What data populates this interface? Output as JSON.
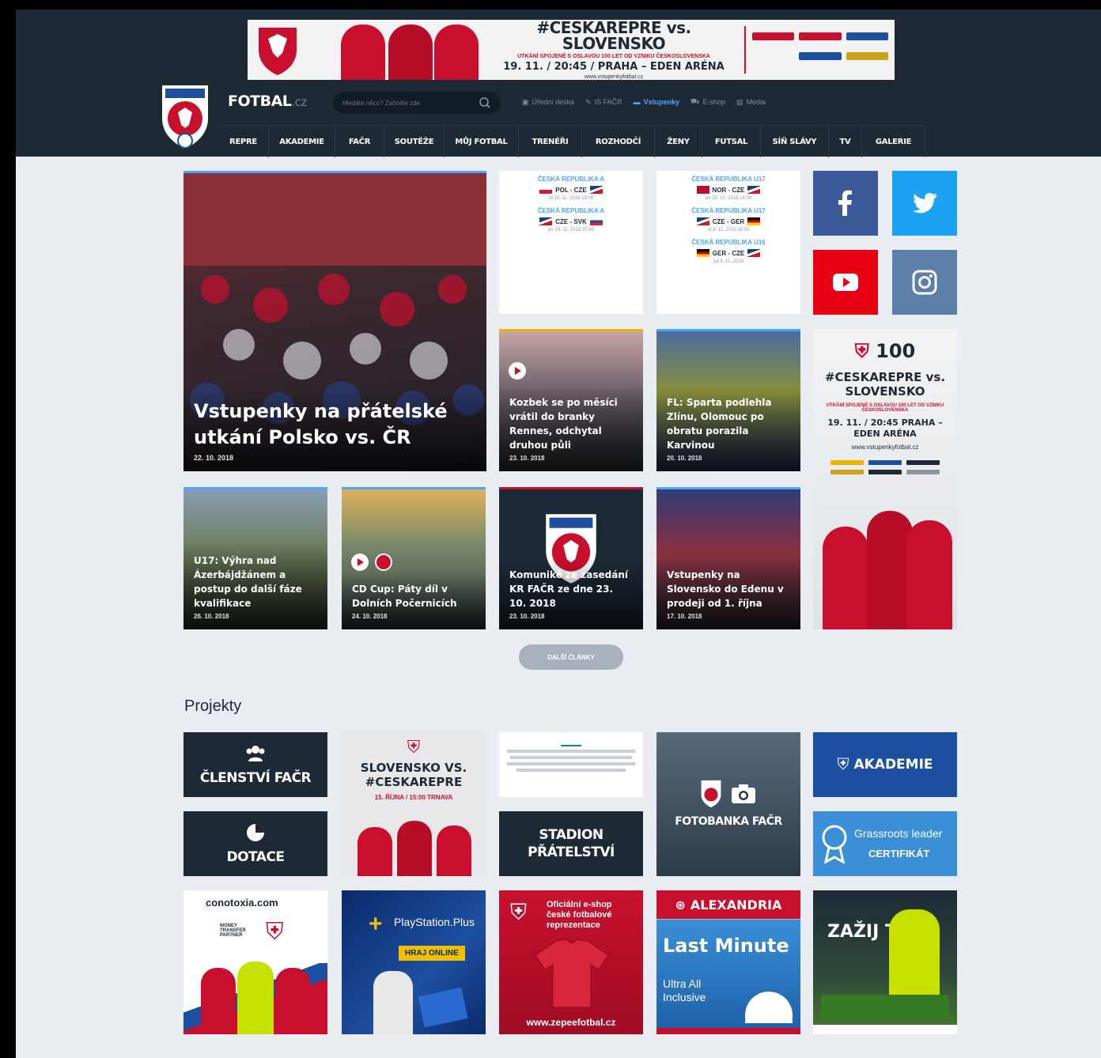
{
  "banner": {
    "headline": "#CESKAREPRE vs. SLOVENSKO",
    "subline": "UTKÁNÍ SPOJENÉ S OSLAVOU 100 LET OD VZNIKU ČESKOSLOVENSKA",
    "date_place": "19. 11. / 20:45 / PRAHA – EDEN ARÉNA",
    "url": "www.vstupenkyfotbal.cz"
  },
  "header": {
    "brand": "FOTBAL",
    "brand_suffix": ".cz",
    "search_placeholder": "Hledáte něco? Začněte zde",
    "links": [
      {
        "label": "Úřední deska",
        "icon": "calendar-icon",
        "glyph": "▣"
      },
      {
        "label": "IS FAČR",
        "icon": "pencil-icon",
        "glyph": "✎"
      },
      {
        "label": "Vstupenky",
        "icon": "ticket-icon",
        "glyph": "▬"
      },
      {
        "label": "E-shop",
        "icon": "cart-icon",
        "glyph": "⛟"
      },
      {
        "label": "Média",
        "icon": "media-icon",
        "glyph": "▤"
      }
    ],
    "nav": [
      "REPRE",
      "AKADEMIE",
      "FAČR",
      "SOUTĚŽE",
      "MŮJ FOTBAL",
      "TRENÉŘI",
      "ROZHODČÍ",
      "ŽENY",
      "FUTSAL",
      "SÍŇ SLÁVY",
      "TV",
      "GALERIE"
    ]
  },
  "hero": {
    "title": "Vstupenky na přátelské utkání Polsko vs. ČR",
    "date": "22. 10. 2018"
  },
  "matches_a": [
    {
      "team": "ČESKÁ REPUBLIKA A",
      "line": "POL - CZE",
      "date": "út 15. 11. 2018 18:00"
    },
    {
      "team": "ČESKÁ REPUBLIKA A",
      "line": "CZE - SVK",
      "date": "po 19. 11. 2018 20:45"
    }
  ],
  "matches_b": [
    {
      "team": "ČESKÁ REPUBLIKA U17",
      "line": "NOR - CZE",
      "date": "po 29. 10. 2018 14:00"
    },
    {
      "team": "ČESKÁ REPUBLIKA U17",
      "line": "CZE - GER",
      "date": "út 6. 11. 2018 16:00"
    },
    {
      "team": "ČESKÁ REPUBLIKA U16",
      "line": "GER - CZE",
      "date": "pá 6. 11. 2018"
    }
  ],
  "articles": [
    {
      "title": "Kozbek se po měsíci vrátil do branky Rennes, odchytal druhou půli",
      "date": "23. 10. 2018"
    },
    {
      "title": "FL: Sparta podlehla Zlínu, Olomouc po obratu porazila Karvinou",
      "date": "20. 10. 2018"
    },
    {
      "title": "U17: Výhra nad Ázerbájdžánem a postup do další fáze kvalifikace",
      "date": "26. 10. 2018"
    },
    {
      "title": "CD Cup: Páty díl v Dolních Počernicích",
      "date": "24. 10. 2018"
    },
    {
      "title": "Komuniké ze zasedání KR FAČR ze dne 23. 10. 2018",
      "date": "23. 10. 2018"
    },
    {
      "title": "Vstupenky na Slovensko do Edenu v prodeji od 1. října",
      "date": "17. 10. 2018"
    }
  ],
  "sidead": {
    "badge": "100",
    "headline": "#CESKAREPRE vs. SLOVENSKO",
    "subline": "UTKÁNÍ SPOJENÉ S OSLAVOU 100 LET OD VZNIKU ČESKOSLOVENSKA",
    "date_place": "19. 11. / 20:45 PRAHA – EDEN ARÉNA",
    "url": "www.vstupenkyfotbal.cz"
  },
  "more_button": "DALŠÍ ČLÁNKY",
  "projects_title": "Projekty",
  "projects": {
    "clenstvi": "ČLENSTVÍ FAČR",
    "dotace": "DOTACE",
    "stadion": "STADION PŘÁTELSTVÍ",
    "fotobanka": "FOTOBANKA FAČR",
    "akademie": "AKADEMIE",
    "grassroots": "Grassroots leader",
    "certifikat": "CERTIFIKÁT",
    "slovensko": "SLOVENSKO VS. #CESKAREPRE",
    "slovensko_date": "15. ŘÍJNA / 15:00 TRNAVA"
  },
  "ads": {
    "conotoxia": "conotoxia.com",
    "money": "MONEY TRANSFER PARTNER",
    "playstation": "PlayStation.Plus",
    "hraj": "HRAJ ONLINE",
    "eshop": "Oficiální e-shop české fotbalové reprezentace",
    "eshop_url": "www.zepeefotbal.cz",
    "alexandria": "ALEXANDRIA",
    "lastminute": "Last Minute",
    "ultra": "Ultra All Inclusive",
    "zazij": "ZAŽIJ TO"
  },
  "colors": {
    "header": "#1d2a36",
    "page": "#e9edf2",
    "accent_red": "#c8102e",
    "accent_blue": "#4ea3ff",
    "facebook": "#3b5998",
    "twitter": "#1da1f2",
    "youtube": "#e60012",
    "instagram": "#5b7fa8"
  }
}
